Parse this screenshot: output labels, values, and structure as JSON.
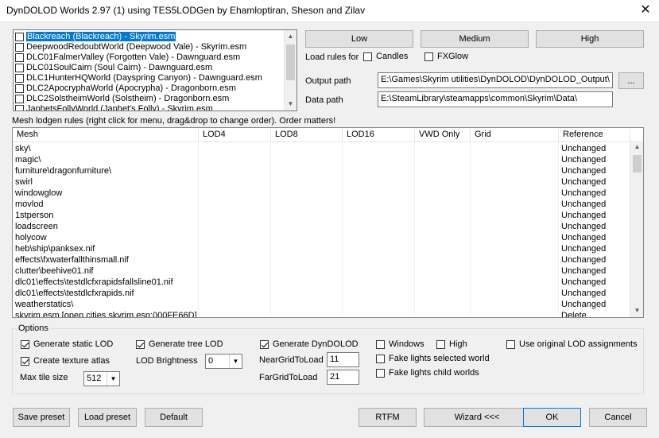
{
  "window": {
    "title": "DynDOLOD Worlds 2.97 (1) using TES5LODGen by Ehamloptiran, Sheson and Zilav",
    "close_glyph": "✕"
  },
  "worlds": [
    {
      "label": "Blackreach (Blackreach) - Skyrim.esm",
      "checked": false,
      "selected": true
    },
    {
      "label": "DeepwoodRedoubtWorld (Deepwood Vale) - Skyrim.esm",
      "checked": false,
      "selected": false
    },
    {
      "label": "DLC01FalmerValley (Forgotten Vale) - Dawnguard.esm",
      "checked": false,
      "selected": false
    },
    {
      "label": "DLC01SoulCairn (Soul Cairn) - Dawnguard.esm",
      "checked": false,
      "selected": false
    },
    {
      "label": "DLC1HunterHQWorld (Dayspring Canyon) - Dawnguard.esm",
      "checked": false,
      "selected": false
    },
    {
      "label": "DLC2ApocryphaWorld (Apocrypha) - Dragonborn.esm",
      "checked": false,
      "selected": false
    },
    {
      "label": "DLC2SolstheimWorld (Solstheim) - Dragonborn.esm",
      "checked": false,
      "selected": false
    },
    {
      "label": "JaphetsFollyWorld (Japhet's Folly) - Skyrim.esm",
      "checked": false,
      "selected": false
    }
  ],
  "presets": {
    "low": "Low",
    "medium": "Medium",
    "high": "High"
  },
  "load_rules": {
    "label": "Load rules for",
    "candles": "Candles",
    "fxglow": "FXGlow"
  },
  "paths": {
    "output_label": "Output path",
    "output_value": "E:\\Games\\Skyrim utilities\\DynDOLOD\\DynDOLOD_Output\\",
    "browse": "...",
    "data_label": "Data path",
    "data_value": "E:\\SteamLibrary\\steamapps\\common\\Skyrim\\Data\\"
  },
  "rules": {
    "caption": "Mesh lodgen rules (right click for menu, drag&drop to change order). Order matters!",
    "headers": [
      "Mesh",
      "LOD4",
      "LOD8",
      "LOD16",
      "VWD Only",
      "Grid",
      "Reference"
    ],
    "rows": [
      {
        "mesh": "sky\\",
        "reference": "Unchanged"
      },
      {
        "mesh": "magic\\",
        "reference": "Unchanged"
      },
      {
        "mesh": "furniture\\dragonfurniture\\",
        "reference": "Unchanged"
      },
      {
        "mesh": "swirl",
        "reference": "Unchanged"
      },
      {
        "mesh": "windowglow",
        "reference": "Unchanged"
      },
      {
        "mesh": "movlod",
        "reference": "Unchanged"
      },
      {
        "mesh": "1stperson",
        "reference": "Unchanged"
      },
      {
        "mesh": "loadscreen",
        "reference": "Unchanged"
      },
      {
        "mesh": "holycow",
        "reference": "Unchanged"
      },
      {
        "mesh": "heb\\ship\\panksex.nif",
        "reference": "Unchanged"
      },
      {
        "mesh": "effects\\fxwaterfallthinsmall.nif",
        "reference": "Unchanged"
      },
      {
        "mesh": "clutter\\beehive01.nif",
        "reference": "Unchanged"
      },
      {
        "mesh": "dlc01\\effects\\testdlcfxrapidsfallsline01.nif",
        "reference": "Unchanged"
      },
      {
        "mesh": "dlc01\\effects\\testdlcfxrapids.nif",
        "reference": "Unchanged"
      },
      {
        "mesh": "weatherstatics\\",
        "reference": "Unchanged"
      },
      {
        "mesh": "skyrim.esm [open cities skyrim.esp:000FE66D]",
        "reference": "Delete"
      }
    ]
  },
  "options": {
    "legend": "Options",
    "generate_static_lod": "Generate static LOD",
    "generate_tree_lod": "Generate tree LOD",
    "generate_dyndolod": "Generate DynDOLOD",
    "windows": "Windows",
    "high": "High",
    "use_original": "Use original LOD assignments",
    "create_texture_atlas": "Create texture atlas",
    "lod_brightness_label": "LOD Brightness",
    "lod_brightness_value": "0",
    "near_grid_label": "NearGridToLoad",
    "near_grid_value": "11",
    "fake_lights_selected": "Fake lights selected world",
    "max_tile_label": "Max tile size",
    "max_tile_value": "512",
    "far_grid_label": "FarGridToLoad",
    "far_grid_value": "21",
    "fake_lights_child": "Fake lights child worlds"
  },
  "footer": {
    "save_preset": "Save preset",
    "load_preset": "Load preset",
    "default": "Default",
    "rtfm": "RTFM",
    "wizard": "Wizard <<<",
    "ok": "OK",
    "cancel": "Cancel"
  }
}
